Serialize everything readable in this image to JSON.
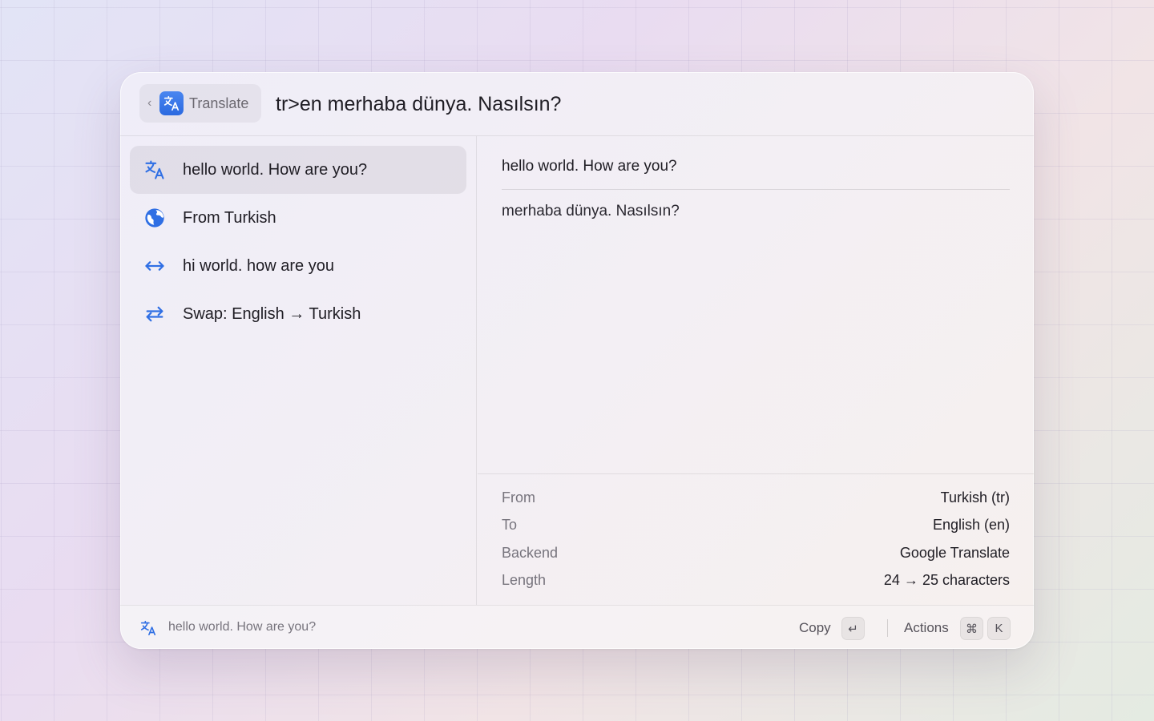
{
  "header": {
    "back_chevron": "‹",
    "app_icon": "translate-icon",
    "app_label": "Translate",
    "query": "tr>en merhaba dünya. Nasılsın?"
  },
  "list": {
    "items": [
      {
        "icon": "translate-icon",
        "label": "hello world. How are you?",
        "selected": true
      },
      {
        "icon": "globe-icon",
        "label": "From Turkish",
        "selected": false
      },
      {
        "icon": "arrows-horizontal-icon",
        "label": "hi world. how are you",
        "selected": false
      },
      {
        "icon": "swap-icon",
        "label": "Swap: English → Turkish",
        "selected": false
      }
    ]
  },
  "detail": {
    "translated_text": "hello world. How are you?",
    "original_text": "merhaba dünya. Nasılsın?",
    "metadata": [
      {
        "key": "From",
        "value": "Turkish (tr)"
      },
      {
        "key": "To",
        "value": "English (en)"
      },
      {
        "key": "Backend",
        "value": "Google Translate"
      },
      {
        "key": "Length",
        "value": "24 → 25 characters"
      }
    ]
  },
  "footer": {
    "icon": "translate-icon",
    "selection_text": "hello world. How are you?",
    "copy_label": "Copy",
    "copy_key": "↵",
    "actions_label": "Actions",
    "actions_keys": [
      "⌘",
      "K"
    ]
  },
  "colors": {
    "accent": "#2f6fe4",
    "text": "#1f1d24",
    "muted": "#77747d"
  }
}
